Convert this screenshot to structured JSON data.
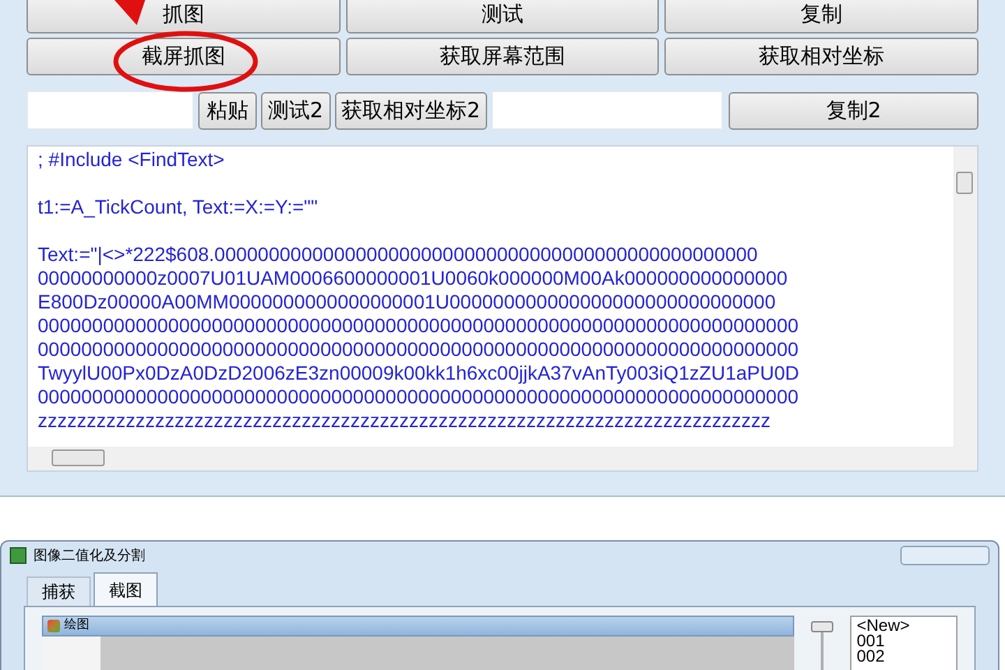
{
  "main_buttons": [
    {
      "label": "抓图"
    },
    {
      "label": "测试"
    },
    {
      "label": "复制"
    },
    {
      "label": "截屏抓图",
      "highlighted": true
    },
    {
      "label": "获取屏幕范围"
    },
    {
      "label": "获取相对坐标"
    }
  ],
  "toolbar": {
    "paste_button": "粘贴",
    "test2_button": "测试2",
    "coords2_button": "获取相对坐标2",
    "copy2_button": "复制2"
  },
  "editor": {
    "blocks": [
      [
        "; #Include <FindText>"
      ],
      [
        "t1:=A_TickCount, Text:=X:=Y:=\"\""
      ],
      [
        "Text:=\"|<>*222$608.00000000000000000000000000000000000000000000000000",
        "00000000000z0007U01UAM0006600000001U0060k000000M00Ak000000000000000",
        "E800Dz00000A00MM0000000000000000001U000000000000000000000000000000",
        "0000000000000000000000000000000000000000000000000000000000000000000000",
        "0000000000000000000000000000000000000000000000000000000000000000000000",
        "TwyylU00Px0DzA0DzD2006zE3zn00009k00kk1h6xc00jjkA37vAnTy003iQ1zZU1aPU0D",
        "0000000000000000000000000000000000000000000000000000000000000000000000",
        "zzzzzzzzzzzzzzzzzzzzzzzzzzzzzzzzzzzzzzzzzzzzzzzzzzzzzzzzzzzzzzzzzzzzzzzzzzz"
      ]
    ]
  },
  "second_window": {
    "title": "图像二值化及分割",
    "tabs": [
      {
        "label": "捕获",
        "selected": false
      },
      {
        "label": "截图",
        "selected": true
      }
    ],
    "panel_title": "绘图",
    "slider": {
      "level": 1
    },
    "list_items": [
      "<New>",
      "001",
      "002"
    ]
  }
}
